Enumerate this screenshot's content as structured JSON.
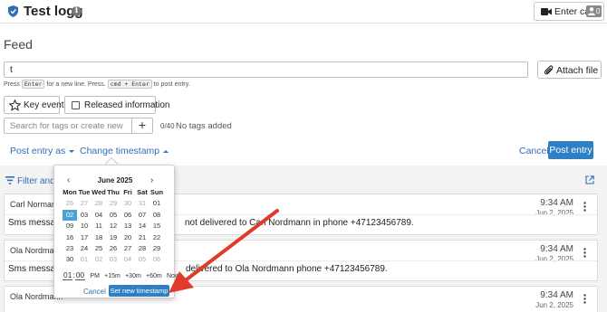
{
  "header": {
    "title": "Test logg",
    "info_icon": "info-icon",
    "enter_call_label": "Enter call",
    "call_participants": "0",
    "icons": {
      "shield": "shield-icon",
      "camera": "video-camera-icon",
      "person": "person-icon"
    }
  },
  "page_heading": "Feed",
  "entry": {
    "value": "t",
    "hint": {
      "press": "Press",
      "enter_key": "Enter",
      "enter_text": "for a new line. Press.",
      "post_key": "cmd + Enter",
      "post_text": "to post entry."
    },
    "attach_label": "Attach file"
  },
  "toggles": {
    "key_event_label": "Key event",
    "released_label": "Released information"
  },
  "tags": {
    "placeholder": "Search for tags or create new",
    "add_symbol": "+",
    "count": "0/40",
    "status": "No tags added"
  },
  "actions": {
    "post_as_label": "Post entry as",
    "change_timestamp_label": "Change timestamp",
    "cancel_label": "Cancel",
    "post_label": "Post entry"
  },
  "filter": {
    "label": "Filter and m"
  },
  "feed": [
    {
      "author": "Carl Normann",
      "time": "9:34 AM",
      "date": "Jun 2, 2025",
      "body_start": "Sms message",
      "body_end": "not delivered to Carl Nordmann in phone +47123456789."
    },
    {
      "author": "Ola Nordmann",
      "time": "9:34 AM",
      "date": "Jun 2, 2025",
      "body_start": "Sms message",
      "body_end": "delivered to Ola Nordmann phone +47123456789."
    },
    {
      "author": "Ola Nordmann",
      "time": "9:34 AM",
      "date": "Jun 2, 2025",
      "body_start": "",
      "body_end": ""
    }
  ],
  "picker": {
    "month": "June 2025",
    "prev": "‹",
    "next": "›",
    "weekdays": [
      "Mon",
      "Tue",
      "Wed",
      "Thu",
      "Fri",
      "Sat",
      "Sun"
    ],
    "weeks": [
      [
        "26",
        "27",
        "28",
        "29",
        "30",
        "31",
        "01"
      ],
      [
        "02",
        "03",
        "04",
        "05",
        "06",
        "07",
        "08"
      ],
      [
        "09",
        "10",
        "11",
        "12",
        "13",
        "14",
        "15"
      ],
      [
        "16",
        "17",
        "18",
        "19",
        "20",
        "21",
        "22"
      ],
      [
        "23",
        "24",
        "25",
        "26",
        "27",
        "28",
        "29"
      ],
      [
        "30",
        "01",
        "02",
        "03",
        "04",
        "05",
        "06"
      ]
    ],
    "muted_before": 6,
    "muted_after_index": 1,
    "selected_day": "02",
    "time_hour": "01",
    "time_minute": "00",
    "time_period": "PM",
    "quick": [
      "+15m",
      "+30m",
      "+60m",
      "Now"
    ],
    "cancel_label": "Cancel",
    "set_label": "Set new timestamp"
  },
  "colors": {
    "accent": "#2f7fc4",
    "link": "#2f6fb5",
    "selected_day": "#4aa3d3",
    "annotation": "#e03a2b"
  }
}
